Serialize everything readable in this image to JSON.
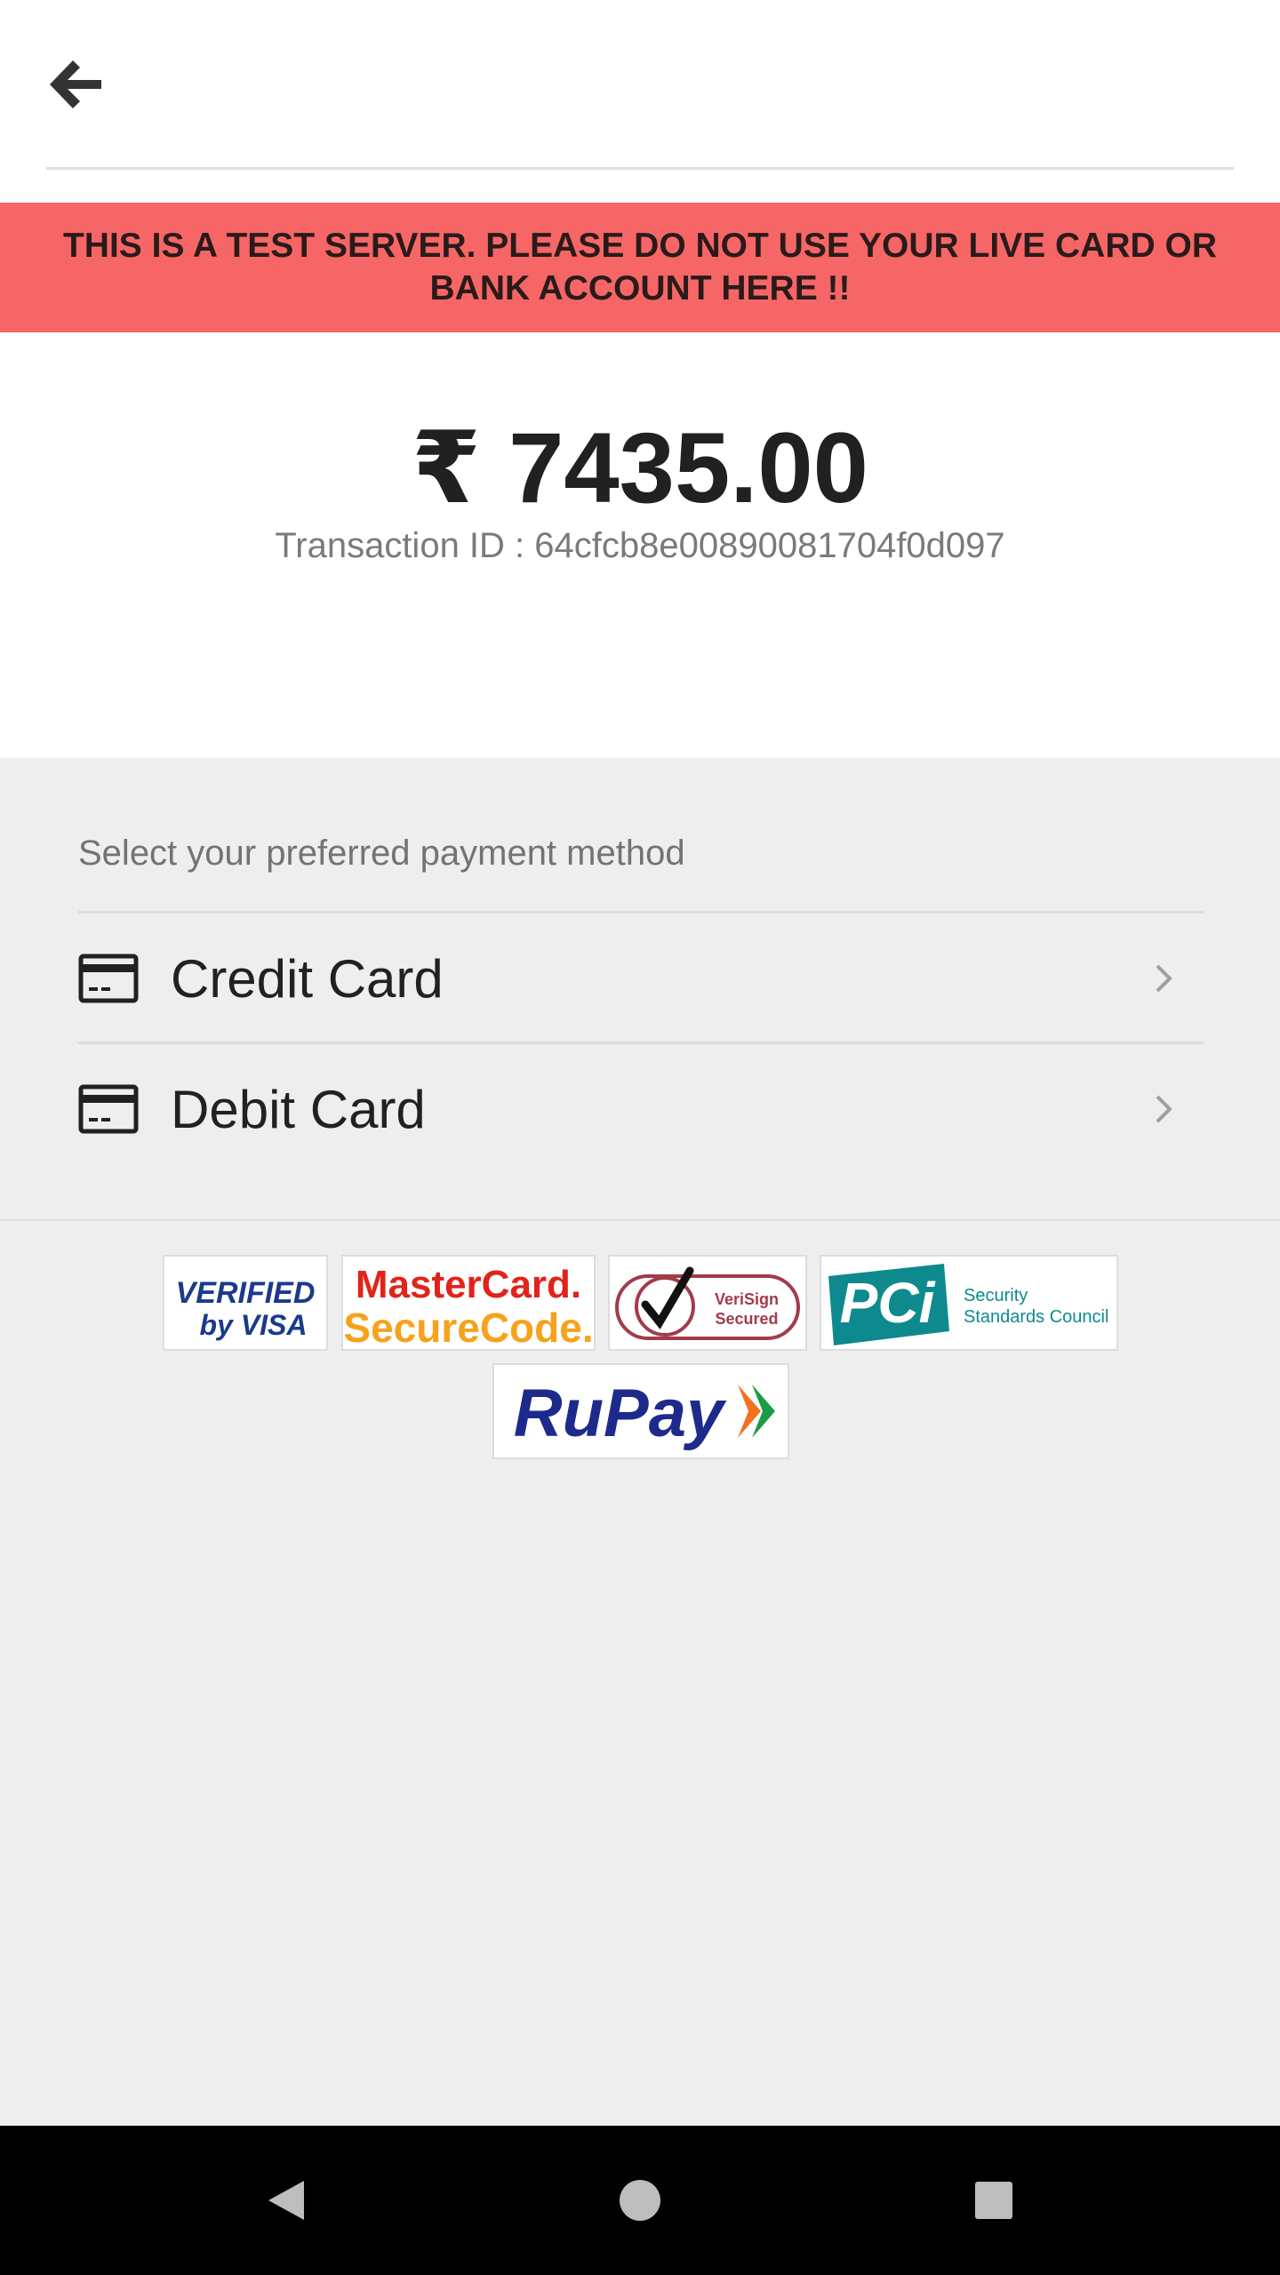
{
  "header": {
    "back_icon": "arrow-left-icon"
  },
  "banner": {
    "text": "THIS IS A TEST SERVER. PLEASE DO NOT USE YOUR LIVE CARD OR BANK ACCOUNT HERE !!"
  },
  "payment": {
    "amount": "₹ 7435.00",
    "transaction_label": "Transaction ID : 64cfcb8e00890081704f0d097"
  },
  "methods": {
    "title": "Select your preferred payment method",
    "items": [
      {
        "label": "Credit Card",
        "icon": "credit-card-icon"
      },
      {
        "label": "Debit Card",
        "icon": "credit-card-icon"
      }
    ]
  },
  "security_logos": {
    "verified_visa": {
      "line1": "VERIFIED",
      "line2": "by VISA"
    },
    "mastercard": {
      "line1": "MasterCard.",
      "line2": "SecureCode."
    },
    "verisign": {
      "line1": "VeriSign",
      "line2": "Secured"
    },
    "pci": {
      "mark": "PCi",
      "line1": "Security",
      "line2": "Standards Council"
    },
    "rupay": {
      "text": "RuPay"
    }
  },
  "colors": {
    "banner_bg": "#f76666",
    "page_bg": "#eeeeee",
    "nav_bg": "#000000"
  },
  "navbar": {
    "back": "triangle-back-icon",
    "home": "circle-home-icon",
    "recents": "square-recents-icon"
  }
}
